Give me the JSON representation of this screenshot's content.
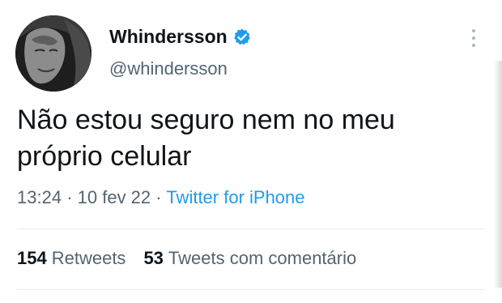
{
  "author": {
    "display_name": "Whindersson",
    "handle": "@whindersson",
    "verified": true,
    "avatar_icon": "profile-photo",
    "verified_icon": "verified-badge-icon",
    "more_icon": "more-options-icon"
  },
  "tweet": {
    "text_line1": "Não estou seguro nem no meu",
    "text_line2": "próprio celular",
    "time": "13:24",
    "date": "10 fev 22",
    "separator": "·",
    "source": "Twitter for iPhone"
  },
  "stats": {
    "retweets_count": "154",
    "retweets_label": "Retweets",
    "quotes_count": "53",
    "quotes_label": "Tweets com comentário"
  },
  "colors": {
    "text": "#0f1419",
    "secondary": "#536471",
    "accent": "#1d9bf0",
    "divider": "#e6ecf0"
  }
}
